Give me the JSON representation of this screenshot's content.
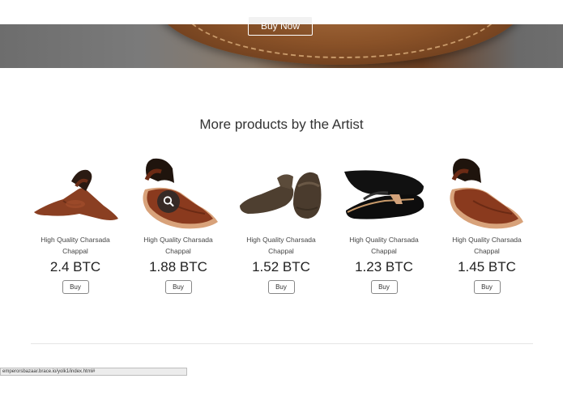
{
  "hero": {
    "button_label": "Buy Now"
  },
  "section": {
    "title": "More products by the Artist"
  },
  "products": [
    {
      "name": "High Quality Charsada Chappal",
      "price": "2.4 BTC",
      "buy_label": "Buy"
    },
    {
      "name": "High Quality Charsada Chappal",
      "price": "1.88 BTC",
      "buy_label": "Buy"
    },
    {
      "name": "High Quality Charsada Chappal",
      "price": "1.52 BTC",
      "buy_label": "Buy"
    },
    {
      "name": "High Quality Charsada Chappal",
      "price": "1.23 BTC",
      "buy_label": "Buy"
    },
    {
      "name": "High Quality Charsada Chappal",
      "price": "1.45 BTC",
      "buy_label": "Buy"
    }
  ],
  "status_bar": {
    "url": "emperorsbazaar.brace.io/yolk1/index.html#"
  },
  "icons": {
    "zoom": "search-icon"
  },
  "colors": {
    "leather_brown": "#8a4a2a",
    "dark_leather": "#5a4a3a",
    "black_leather": "#111111"
  }
}
